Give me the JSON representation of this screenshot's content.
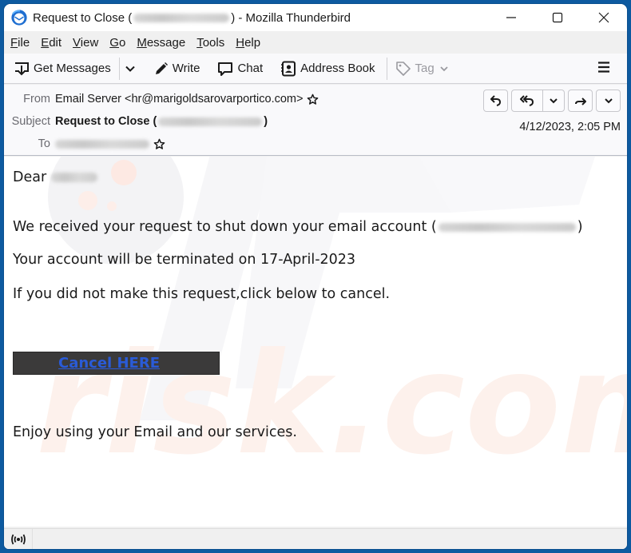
{
  "window": {
    "title_prefix": "Request to Close (",
    "title_suffix": ") - Mozilla Thunderbird",
    "controls": [
      "minimize",
      "maximize",
      "close"
    ]
  },
  "menubar": {
    "items": [
      {
        "accel": "F",
        "rest": "ile"
      },
      {
        "accel": "E",
        "rest": "dit"
      },
      {
        "accel": "V",
        "rest": "iew"
      },
      {
        "accel": "G",
        "rest": "o"
      },
      {
        "accel": "M",
        "rest": "essage"
      },
      {
        "accel": "T",
        "rest": "ools"
      },
      {
        "accel": "H",
        "rest": "elp"
      }
    ]
  },
  "toolbar": {
    "get_messages": "Get Messages",
    "write": "Write",
    "chat": "Chat",
    "address_book": "Address Book",
    "tag": "Tag"
  },
  "header": {
    "from_label": "From",
    "from_value": "Email Server <hr@marigoldsarovarportico.com>",
    "subject_label": "Subject",
    "subject_prefix": "Request to Close (",
    "subject_suffix": ")",
    "to_label": "To",
    "date": "4/12/2023, 2:05 PM"
  },
  "message": {
    "greeting": "Dear",
    "line1_prefix": "We received your request to shut down your email account (",
    "line1_suffix": ")",
    "line2": "Your account will be terminated on 17-April-2023",
    "line3": "If you did not make this request,click below to cancel.",
    "cancel_link": "Cancel HERE",
    "closing": "Enjoy using your Email and our services."
  },
  "colors": {
    "frame": "#0d5aa0",
    "link": "#2a5bd7",
    "button_bg": "#3b3a3a"
  }
}
